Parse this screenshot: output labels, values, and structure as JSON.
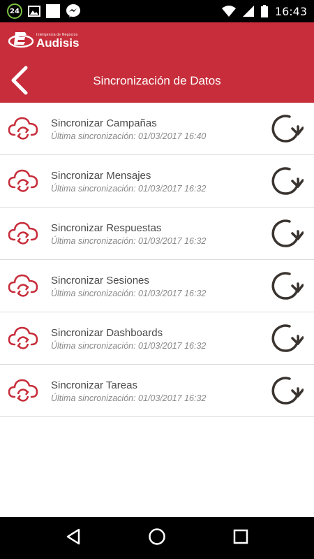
{
  "status_bar": {
    "notification_count": "24",
    "time": "16:43",
    "icons": [
      "notification-badge",
      "image-icon",
      "app-icon",
      "messenger-icon",
      "wifi-icon",
      "signal-icon",
      "battery-icon"
    ]
  },
  "header": {
    "logo_tagline": "Inteligencia de Negocios",
    "logo_name": "Audisis",
    "title": "Sincronización de Datos",
    "back_icon": "chevron-left-icon",
    "color": "#c72d3a"
  },
  "sync_items": [
    {
      "label": "Sincronizar Campañas",
      "last_sync": "Última sincronización: 01/03/2017 16:40"
    },
    {
      "label": "Sincronizar Mensajes",
      "last_sync": "Última sincronización: 01/03/2017 16:32"
    },
    {
      "label": "Sincronizar Respuestas",
      "last_sync": "Última sincronización: 01/03/2017 16:32"
    },
    {
      "label": "Sincronizar Sesiones",
      "last_sync": "Última sincronización: 01/03/2017 16:32"
    },
    {
      "label": "Sincronizar Dashboards",
      "last_sync": "Última sincronización: 01/03/2017 16:32"
    },
    {
      "label": "Sincronizar Tareas",
      "last_sync": "Última sincronización: 01/03/2017 16:32"
    }
  ],
  "icons": {
    "row_icon": "cloud-sync-icon",
    "action_icon": "refresh-icon",
    "accent": "#c72d3a"
  },
  "nav_bar": {
    "buttons": [
      "back-triangle-icon",
      "home-circle-icon",
      "recents-square-icon"
    ]
  }
}
